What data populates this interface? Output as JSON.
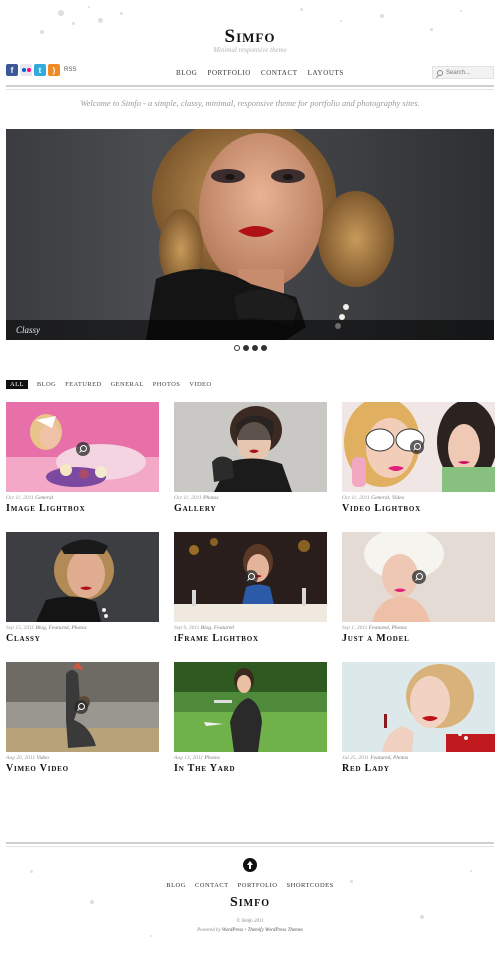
{
  "header": {
    "site_title": "Simfo",
    "tagline": "Minimal responsive theme",
    "social": {
      "facebook_icon": "facebook-icon",
      "flickr_icon": "flickr-icon",
      "twitter_icon": "twitter-icon",
      "rss_icon": "rss-icon",
      "rss_label": "RSS"
    },
    "nav": [
      {
        "label": "Blog"
      },
      {
        "label": "Portfolio"
      },
      {
        "label": "Contact"
      },
      {
        "label": "Layouts"
      }
    ],
    "search_placeholder": "Search..."
  },
  "welcome": "Welcome to Simfo - a simple, classy, minimal, responsive theme for portfolio and photography sites.",
  "slider": {
    "caption": "Classy",
    "slide_count": 4,
    "active_slide": 1
  },
  "filters": [
    {
      "label": "All",
      "active": true
    },
    {
      "label": "Blog",
      "active": false
    },
    {
      "label": "Featured",
      "active": false
    },
    {
      "label": "General",
      "active": false
    },
    {
      "label": "Photos",
      "active": false
    },
    {
      "label": "Video",
      "active": false
    }
  ],
  "posts": [
    {
      "date": "Oct 11, 2011",
      "cats": "General",
      "title": "Image Lightbox"
    },
    {
      "date": "Oct 11, 2011",
      "cats": "Photos",
      "title": "Gallery"
    },
    {
      "date": "Oct 11, 2011",
      "cats": "General, Video",
      "title": "Video Lightbox"
    },
    {
      "date": "Sep 15, 2011",
      "cats": "Blog, Featured, Photos",
      "title": "Classy"
    },
    {
      "date": "Sep 9, 2011",
      "cats": "Blog, Featured",
      "title": "iFrame Lightbox"
    },
    {
      "date": "Sep 1, 2011",
      "cats": "Featured, Photos",
      "title": "Just a Model"
    },
    {
      "date": "Aug 20, 2011",
      "cats": "Video",
      "title": "Vimeo Video"
    },
    {
      "date": "Aug 13, 2011",
      "cats": "Photos",
      "title": "In The Yard"
    },
    {
      "date": "Jul 25, 2011",
      "cats": "Featured, Photos",
      "title": "Red Lady"
    }
  ],
  "footer": {
    "nav": [
      {
        "label": "Blog"
      },
      {
        "label": "Contact"
      },
      {
        "label": "Portfolio"
      },
      {
        "label": "Shortcodes"
      }
    ],
    "title": "Simfo",
    "copyright": "© Simfo 2011",
    "credit_prefix": "Powered by",
    "credit_wp": "WordPress",
    "credit_sep": "•",
    "credit_themify": "Themify WordPress Themes"
  },
  "colors": {
    "accent_dark": "#111111",
    "rule": "#cfcfcf",
    "muted_text": "#9a9a9a",
    "facebook": "#3b5998",
    "twitter": "#33aadd",
    "rss": "#f08a24"
  }
}
